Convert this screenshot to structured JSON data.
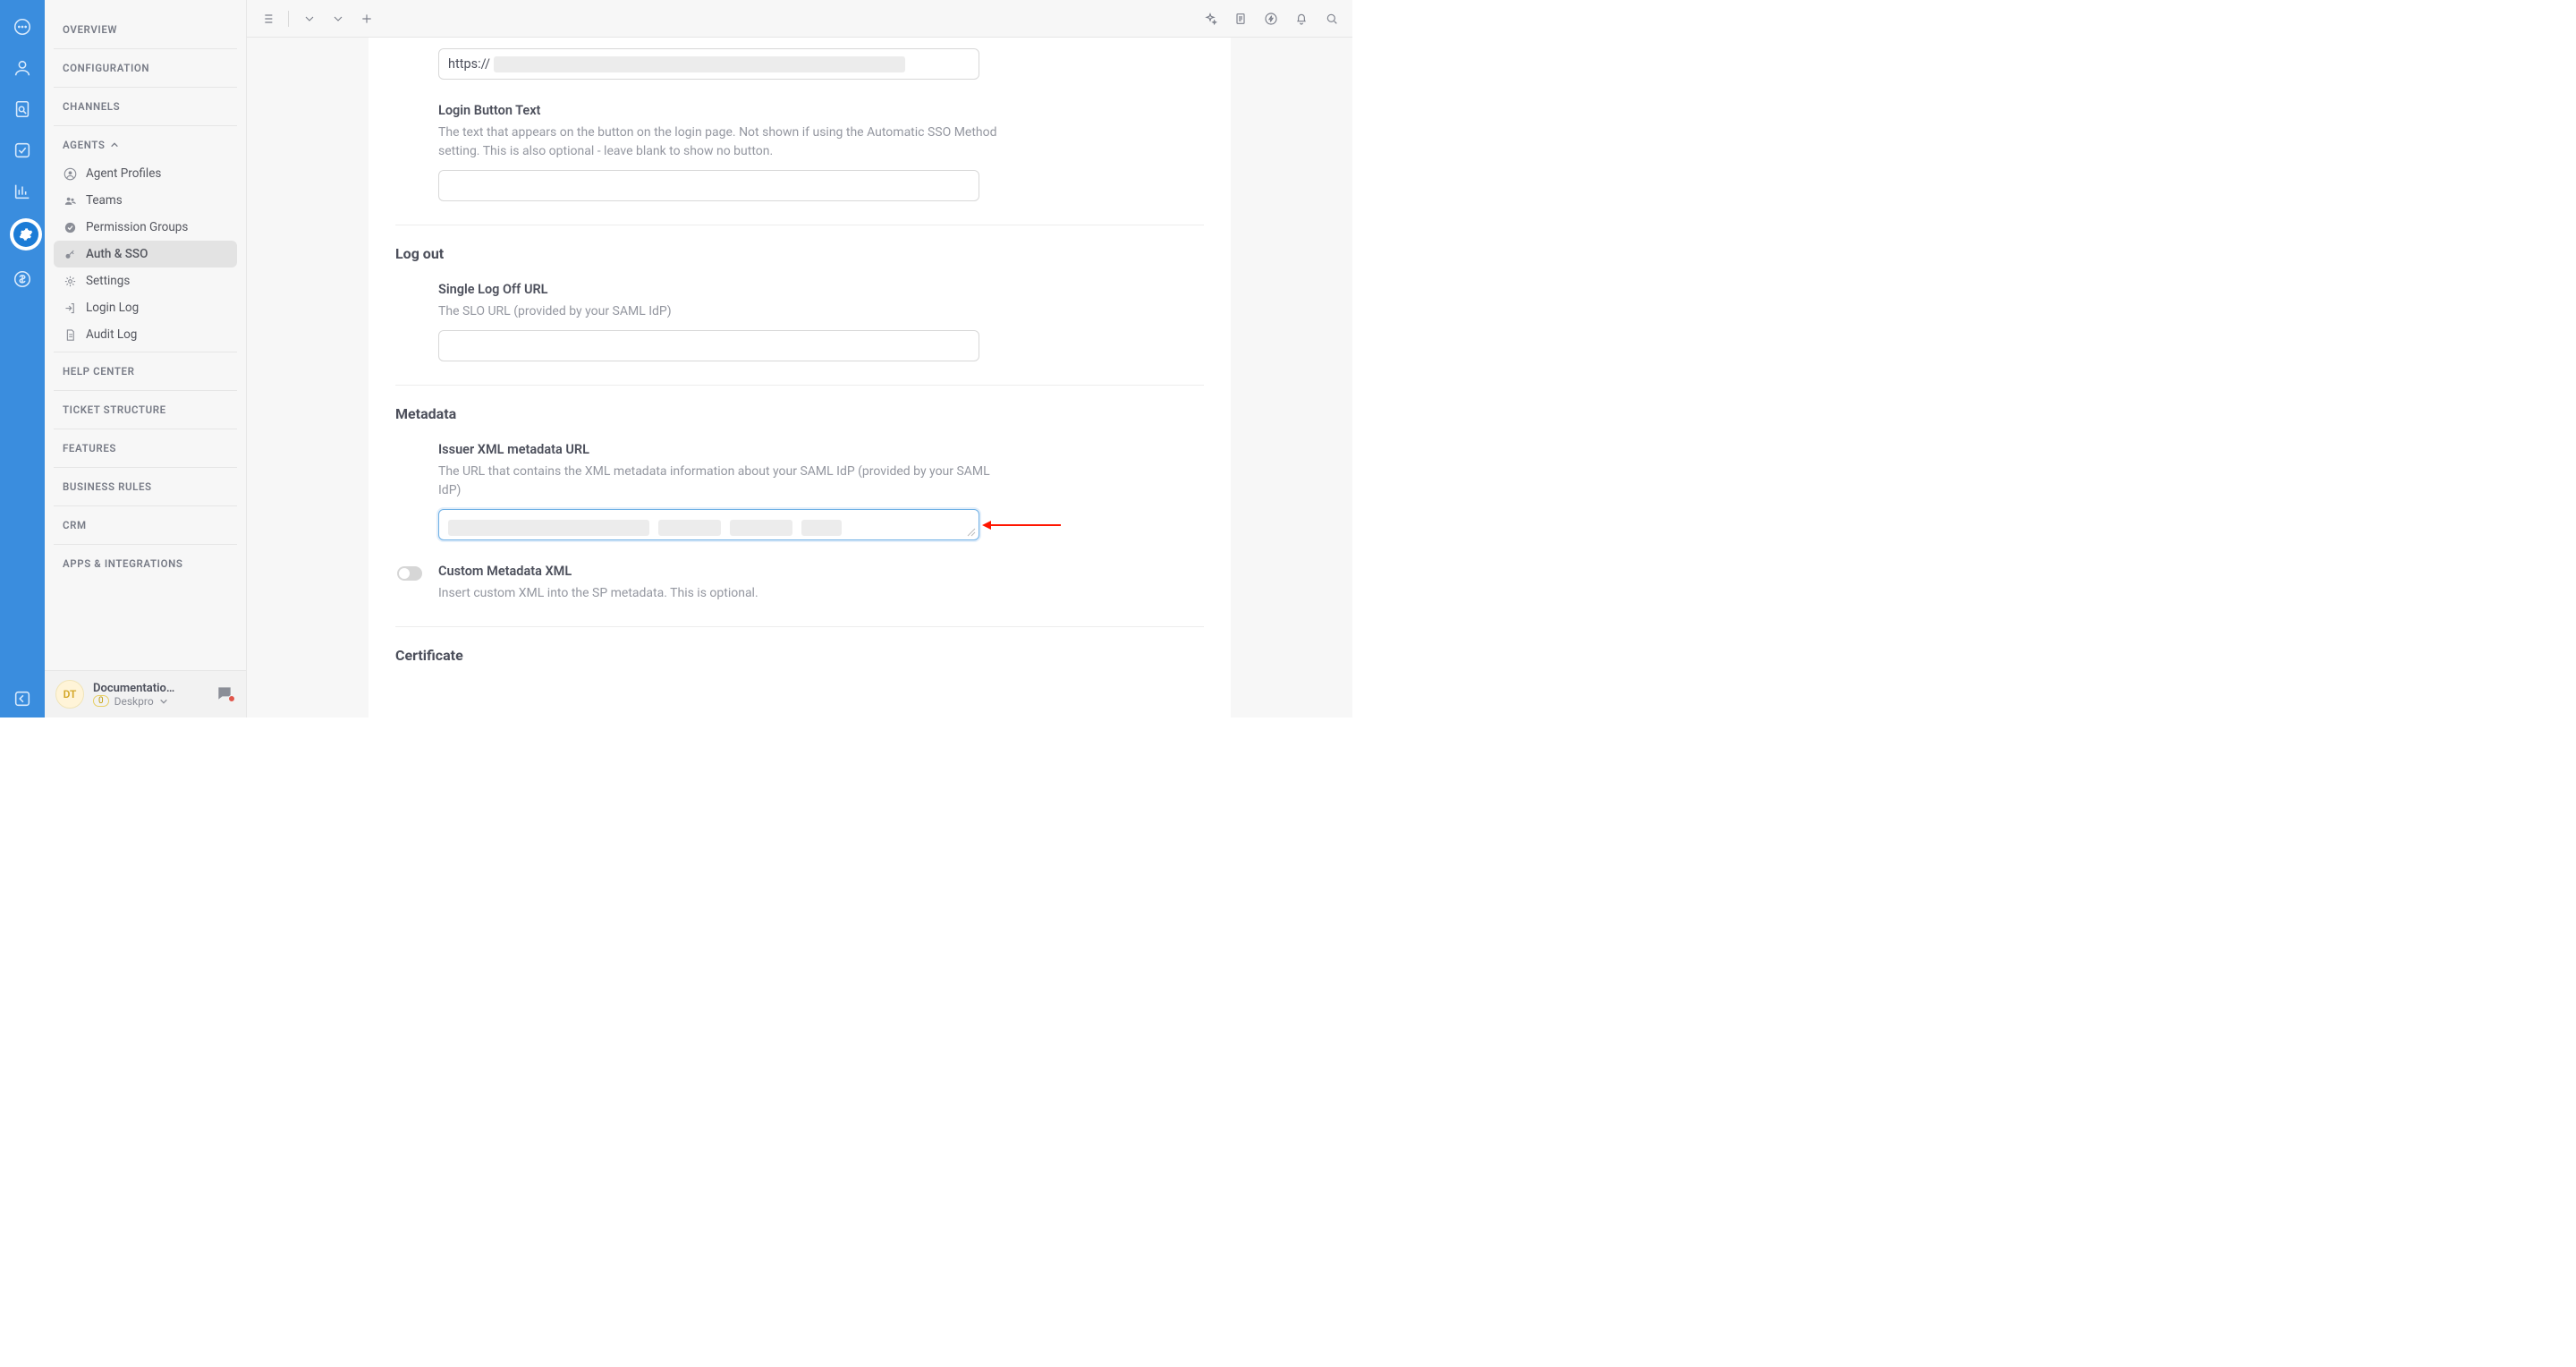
{
  "rail": {},
  "sidebar": {
    "sections": {
      "overview": "Overview",
      "configuration": "Configuration",
      "channels": "Channels",
      "agents": "Agents",
      "help_center": "Help Center",
      "ticket_structure": "Ticket Structure",
      "features": "Features",
      "business_rules": "Business Rules",
      "crm": "CRM",
      "apps_integrations": "Apps & Integrations"
    },
    "agents_items": [
      {
        "label": "Agent Profiles"
      },
      {
        "label": "Teams"
      },
      {
        "label": "Permission Groups"
      },
      {
        "label": "Auth & SSO"
      },
      {
        "label": "Settings"
      },
      {
        "label": "Login Log"
      },
      {
        "label": "Audit Log"
      }
    ],
    "footer": {
      "avatar_initials": "DT",
      "name": "Documentatio…",
      "sub_pill": "0",
      "sub_text": "Deskpro"
    }
  },
  "main": {
    "fields": {
      "https_value": "https://",
      "login_button_text": {
        "label": "Login Button Text",
        "help": "The text that appears on the button on the login page. Not shown if using the Automatic SSO Method setting. This is also optional - leave blank to show no button.",
        "value": ""
      },
      "log_out_heading": "Log out",
      "single_log_off": {
        "label": "Single Log Off URL",
        "help": "The SLO URL (provided by your SAML IdP)",
        "value": ""
      },
      "metadata_heading": "Metadata",
      "issuer_xml": {
        "label": "Issuer XML metadata URL",
        "help": "The URL that contains the XML metadata information about your SAML IdP (provided by your SAML IdP)",
        "value": ""
      },
      "custom_metadata": {
        "label": "Custom Metadata XML",
        "help": "Insert custom XML into the SP metadata. This is optional."
      },
      "certificate_heading": "Certificate"
    }
  }
}
